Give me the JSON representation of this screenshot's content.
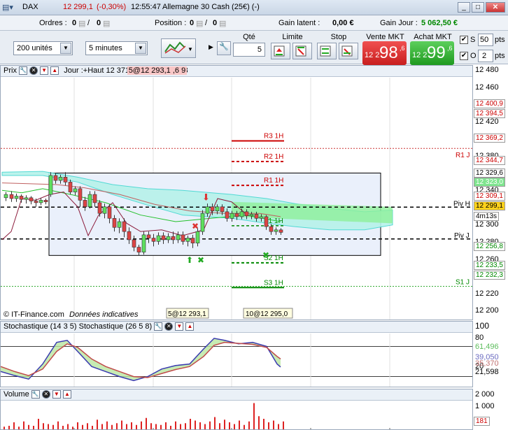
{
  "window": {
    "instrument": "DAX",
    "price": "12 299,1",
    "change": "(-0,30%)",
    "time": "12:55:47",
    "name": "Allemagne 30 Cash (25€) (-)"
  },
  "info": {
    "orders_label": "Ordres :",
    "orders_val": "0",
    "orders_val2": "0",
    "position_label": "Position :",
    "position_val": "0",
    "position_val2": "0",
    "gain_latent_label": "Gain latent :",
    "gain_latent_val": "0,00 €",
    "gain_jour_label": "Gain Jour :",
    "gain_jour_val": "5 062,50 €"
  },
  "toolbar": {
    "units": "200 unités",
    "interval": "5 minutes",
    "qty_label": "Qté",
    "qty": "5",
    "limit_label": "Limite",
    "stop_label": "Stop",
    "sell_label": "Vente MKT",
    "sell_small": "12 2",
    "sell_big": "98",
    "sell_sup": ",6",
    "buy_label": "Achat MKT",
    "buy_small": "12 2",
    "buy_big": "99",
    "buy_sup": ",6",
    "s_label": "S",
    "s_val": "50",
    "o_label": "O",
    "o_val": "2",
    "pts": "pts"
  },
  "price_chart": {
    "title": "Prix",
    "legend": "Jour :+Haut 12 371,2 +Bas 12 271,3",
    "legend_overlay": "5@12 293,1 ,6 9",
    "levels": [
      {
        "name": "R3 1H"
      },
      {
        "name": "R2 1H"
      },
      {
        "name": "R1 1H"
      },
      {
        "name": "S1 1H"
      },
      {
        "name": "S2 1H"
      },
      {
        "name": "S3 1H"
      },
      {
        "name": "R1 J"
      },
      {
        "name": "Piv H"
      },
      {
        "name": "Piv J"
      },
      {
        "name": "S1 J"
      },
      {
        "name": "S1 H"
      }
    ],
    "order_labels": [
      "5@12 293,1",
      "10@12 295,0"
    ],
    "footer": "© IT-Finance.com",
    "footer_note": "Données indicatives",
    "axis_ticks": [
      "12 480",
      "12 460",
      "12 440",
      "12 420",
      "12 400",
      "12 380",
      "12 360",
      "12 340",
      "12 320",
      "12 300",
      "12 280",
      "12 260",
      "12 240",
      "12 220",
      "12 200"
    ],
    "axis_labels": [
      {
        "text": "12 400,9",
        "bg": "#fff",
        "color": "#c00"
      },
      {
        "text": "12 394,5",
        "bg": "#fff",
        "color": "#c00"
      },
      {
        "text": "12 369,2",
        "bg": "#fff",
        "color": "#c00"
      },
      {
        "text": "12 344,7",
        "bg": "#fff",
        "color": "#c00"
      },
      {
        "text": "12 329,6",
        "bg": "#fff",
        "color": "#000"
      },
      {
        "text": "12 323,0",
        "bg": "#7fe58f",
        "color": "#fff"
      },
      {
        "text": "12 309,1",
        "bg": "#fff",
        "color": "#c00"
      },
      {
        "text": "12 299,1",
        "bg": "#ffd21c",
        "color": "#000"
      },
      {
        "text": "4m13s",
        "bg": "#fff",
        "color": "#000"
      },
      {
        "text": "12 256,8",
        "bg": "#fff",
        "color": "#080"
      },
      {
        "text": "12 233,5",
        "bg": "#fff",
        "color": "#080"
      },
      {
        "text": "12 232,3",
        "bg": "#fff",
        "color": "#080"
      }
    ],
    "axis_extra": [
      "12 295,0",
      "12 293,1"
    ]
  },
  "stoch": {
    "title": "Stochastique (14 3 5) Stochastique (26 5 8)",
    "ticks": [
      "100",
      "80",
      "20"
    ],
    "labels": [
      {
        "text": "61,496",
        "color": "#5dbd5d"
      },
      {
        "text": "39,050",
        "color": "#6a6ac0"
      },
      {
        "text": "35,370",
        "color": "#c07070"
      },
      {
        "text": "21,598",
        "color": "#000"
      }
    ]
  },
  "volume": {
    "title": "Volume",
    "ticks": [
      "2 000",
      "1 000"
    ],
    "last": "181"
  }
}
